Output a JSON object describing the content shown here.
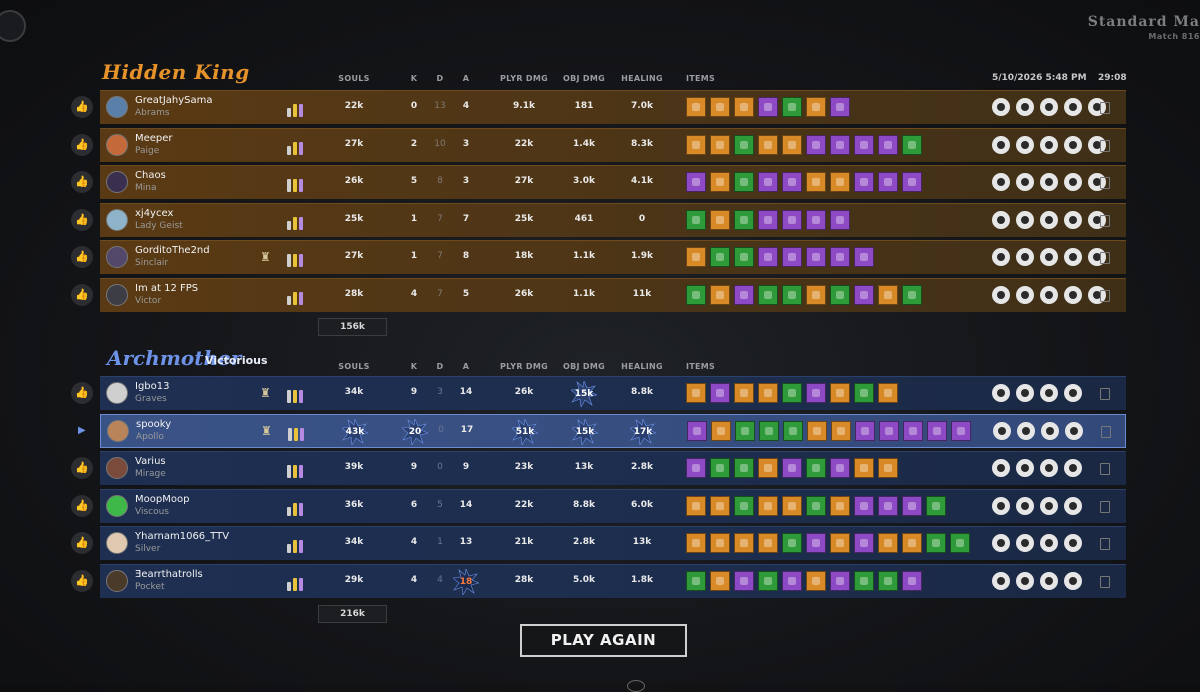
{
  "header": {
    "mode_title": "Standard Ma",
    "match_label": "Match 816",
    "date": "5/10/2026 5:48 PM",
    "duration": "29:08"
  },
  "columns": {
    "souls": "SOULS",
    "k": "K",
    "d": "D",
    "a": "A",
    "plyr_dmg": "PLYR DMG",
    "obj_dmg": "OBJ DMG",
    "healing": "HEALING",
    "items": "ITEMS"
  },
  "teams": [
    {
      "name": "Hidden King",
      "status": "",
      "color": "#e5922b",
      "total_souls": "156k",
      "players": [
        {
          "player": "GreatJahySama",
          "hero": "Abrams",
          "souls": "22k",
          "k": "0",
          "d": "13",
          "a": "4",
          "plyr_dmg": "9.1k",
          "obj_dmg": "181",
          "healing": "7.0k",
          "avatar_color": "#5a7fa8",
          "bars": [
            0.5,
            0.75,
            0.75
          ],
          "items": [
            "#d98a28",
            "#d98a28",
            "#d98a28",
            "#8e49c4",
            "#2f9a3a",
            "#d98a28",
            "#8e49c4"
          ],
          "mods": 5
        },
        {
          "player": "Meeper",
          "hero": "Paige",
          "souls": "27k",
          "k": "2",
          "d": "10",
          "a": "3",
          "plyr_dmg": "22k",
          "obj_dmg": "1.4k",
          "healing": "8.3k",
          "avatar_color": "#c46a3a",
          "bars": [
            0.5,
            0.75,
            0.75
          ],
          "items": [
            "#d98a28",
            "#d98a28",
            "#2f9a3a",
            "#d98a28",
            "#d98a28",
            "#8e49c4",
            "#8e49c4",
            "#8e49c4",
            "#8e49c4",
            "#2f9a3a"
          ],
          "mods": 5
        },
        {
          "player": "Chaos",
          "hero": "Mina",
          "souls": "26k",
          "k": "5",
          "d": "8",
          "a": "3",
          "plyr_dmg": "27k",
          "obj_dmg": "3.0k",
          "healing": "4.1k",
          "avatar_color": "#3b2f4f",
          "bars": [
            0.75,
            0.75,
            0.75
          ],
          "items": [
            "#8e49c4",
            "#d98a28",
            "#2f9a3a",
            "#8e49c4",
            "#8e49c4",
            "#d98a28",
            "#d98a28",
            "#8e49c4",
            "#8e49c4",
            "#8e49c4"
          ],
          "mods": 5
        },
        {
          "player": "xj4ycex",
          "hero": "Lady Geist",
          "souls": "25k",
          "k": "1",
          "d": "7",
          "a": "7",
          "plyr_dmg": "25k",
          "obj_dmg": "461",
          "healing": "0",
          "avatar_color": "#8fb3c8",
          "bars": [
            0.5,
            0.75,
            0.75
          ],
          "items": [
            "#2f9a3a",
            "#d98a28",
            "#2f9a3a",
            "#8e49c4",
            "#8e49c4",
            "#8e49c4",
            "#8e49c4"
          ],
          "mods": 5
        },
        {
          "player": "GorditoThe2nd",
          "hero": "Sinclair",
          "souls": "27k",
          "k": "1",
          "d": "7",
          "a": "8",
          "plyr_dmg": "18k",
          "obj_dmg": "1.1k",
          "healing": "1.9k",
          "avatar_color": "#54486a",
          "bars": [
            0.75,
            0.75,
            0.75
          ],
          "items": [
            "#d98a28",
            "#2f9a3a",
            "#2f9a3a",
            "#8e49c4",
            "#8e49c4",
            "#8e49c4",
            "#8e49c4",
            "#8e49c4"
          ],
          "mods": 5
        },
        {
          "player": "Im at 12 FPS",
          "hero": "Victor",
          "souls": "28k",
          "k": "4",
          "d": "7",
          "a": "5",
          "plyr_dmg": "26k",
          "obj_dmg": "1.1k",
          "healing": "11k",
          "avatar_color": "#3d3d45",
          "bars": [
            0.5,
            0.75,
            0.75
          ],
          "items": [
            "#2f9a3a",
            "#d98a28",
            "#8e49c4",
            "#2f9a3a",
            "#2f9a3a",
            "#d98a28",
            "#2f9a3a",
            "#8e49c4",
            "#d98a28",
            "#2f9a3a"
          ],
          "mods": 5
        }
      ]
    },
    {
      "name": "Archmother",
      "status": "Victorious",
      "color": "#6d93e8",
      "total_souls": "216k",
      "players": [
        {
          "player": "Igbo13",
          "hero": "Graves",
          "souls": "34k",
          "k": "9",
          "d": "3",
          "a": "14",
          "plyr_dmg": "26k",
          "obj_dmg": "15k",
          "healing": "8.8k",
          "avatar_color": "#cfcfcf",
          "bars": [
            0.75,
            0.75,
            0.75
          ],
          "items": [
            "#d98a28",
            "#8e49c4",
            "#d98a28",
            "#d98a28",
            "#2f9a3a",
            "#8e49c4",
            "#d98a28",
            "#2f9a3a",
            "#d98a28"
          ],
          "mods": 4
        },
        {
          "player": "spooky",
          "hero": "Apollo",
          "souls": "43k",
          "k": "20",
          "d": "0",
          "a": "17",
          "plyr_dmg": "51k",
          "obj_dmg": "15k",
          "healing": "17k",
          "avatar_color": "#b9845a",
          "bars": [
            0.75,
            0.75,
            0.75
          ],
          "items": [
            "#8e49c4",
            "#d98a28",
            "#2f9a3a",
            "#2f9a3a",
            "#2f9a3a",
            "#d98a28",
            "#d98a28",
            "#8e49c4",
            "#8e49c4",
            "#8e49c4",
            "#8e49c4",
            "#8e49c4"
          ],
          "mods": 4
        },
        {
          "player": "Varius",
          "hero": "Mirage",
          "souls": "39k",
          "k": "9",
          "d": "0",
          "a": "9",
          "plyr_dmg": "23k",
          "obj_dmg": "13k",
          "healing": "2.8k",
          "avatar_color": "#7a4a3a",
          "bars": [
            0.75,
            0.75,
            0.75
          ],
          "items": [
            "#8e49c4",
            "#2f9a3a",
            "#2f9a3a",
            "#d98a28",
            "#8e49c4",
            "#2f9a3a",
            "#8e49c4",
            "#d98a28",
            "#d98a28"
          ],
          "mods": 4
        },
        {
          "player": "MoopMoop",
          "hero": "Viscous",
          "souls": "36k",
          "k": "6",
          "d": "5",
          "a": "14",
          "plyr_dmg": "22k",
          "obj_dmg": "8.8k",
          "healing": "6.0k",
          "avatar_color": "#3fb84a",
          "bars": [
            0.5,
            0.75,
            0.75
          ],
          "items": [
            "#d98a28",
            "#d98a28",
            "#2f9a3a",
            "#d98a28",
            "#d98a28",
            "#2f9a3a",
            "#d98a28",
            "#8e49c4",
            "#8e49c4",
            "#8e49c4",
            "#2f9a3a"
          ],
          "mods": 4
        },
        {
          "player": "Yharnam1066_TTV",
          "hero": "Silver",
          "souls": "34k",
          "k": "4",
          "d": "1",
          "a": "13",
          "plyr_dmg": "21k",
          "obj_dmg": "2.8k",
          "healing": "13k",
          "avatar_color": "#e0c9b0",
          "bars": [
            0.5,
            0.75,
            0.75
          ],
          "items": [
            "#d98a28",
            "#d98a28",
            "#d98a28",
            "#d98a28",
            "#2f9a3a",
            "#8e49c4",
            "#d98a28",
            "#8e49c4",
            "#d98a28",
            "#d98a28",
            "#2f9a3a",
            "#2f9a3a"
          ],
          "mods": 4
        },
        {
          "player": "Ǝearrthatrolls",
          "hero": "Pocket",
          "souls": "29k",
          "k": "4",
          "d": "4",
          "a": "18",
          "plyr_dmg": "28k",
          "obj_dmg": "5.0k",
          "healing": "1.8k",
          "avatar_color": "#4a3a2a",
          "bars": [
            0.5,
            0.75,
            0.75
          ],
          "items": [
            "#2f9a3a",
            "#d98a28",
            "#8e49c4",
            "#2f9a3a",
            "#8e49c4",
            "#d98a28",
            "#8e49c4",
            "#2f9a3a",
            "#2f9a3a",
            "#8e49c4"
          ],
          "mods": 4
        }
      ]
    }
  ],
  "highlights": {
    "archmother": {
      "obj_dmg_rows": [
        0,
        1
      ],
      "player_rows": {
        "1": [
          "souls",
          "k",
          "plyr_dmg",
          "obj_dmg",
          "healing"
        ]
      },
      "assist_row": 5
    }
  },
  "buttons": {
    "play_again": "PLAY AGAIN"
  },
  "colors": {
    "amber": "#e5922b",
    "blue": "#6d93e8",
    "item_orange": "#d98a28",
    "item_green": "#2f9a3a",
    "item_purple": "#8e49c4"
  }
}
